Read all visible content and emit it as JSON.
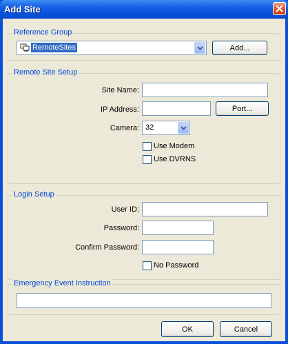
{
  "window": {
    "title": "Add Site"
  },
  "reference_group": {
    "label": "Reference Group",
    "selected": "RemoteSites",
    "add_button": "Add..."
  },
  "remote_site": {
    "label": "Remote Site Setup",
    "site_name_label": "Site Name:",
    "site_name_value": "",
    "ip_label": "IP Address:",
    "ip_value": "",
    "port_button": "Port...",
    "camera_label": "Camera:",
    "camera_value": "32",
    "use_modem": "Use Modem",
    "use_dvrns": "Use DVRNS"
  },
  "login": {
    "label": "Login Setup",
    "user_id_label": "User ID:",
    "password_label": "Password:",
    "confirm_label": "Confirm Password:",
    "no_password": "No Password"
  },
  "emergency": {
    "label": "Emergency Event Instruction",
    "value": ""
  },
  "footer": {
    "ok": "OK",
    "cancel": "Cancel"
  }
}
